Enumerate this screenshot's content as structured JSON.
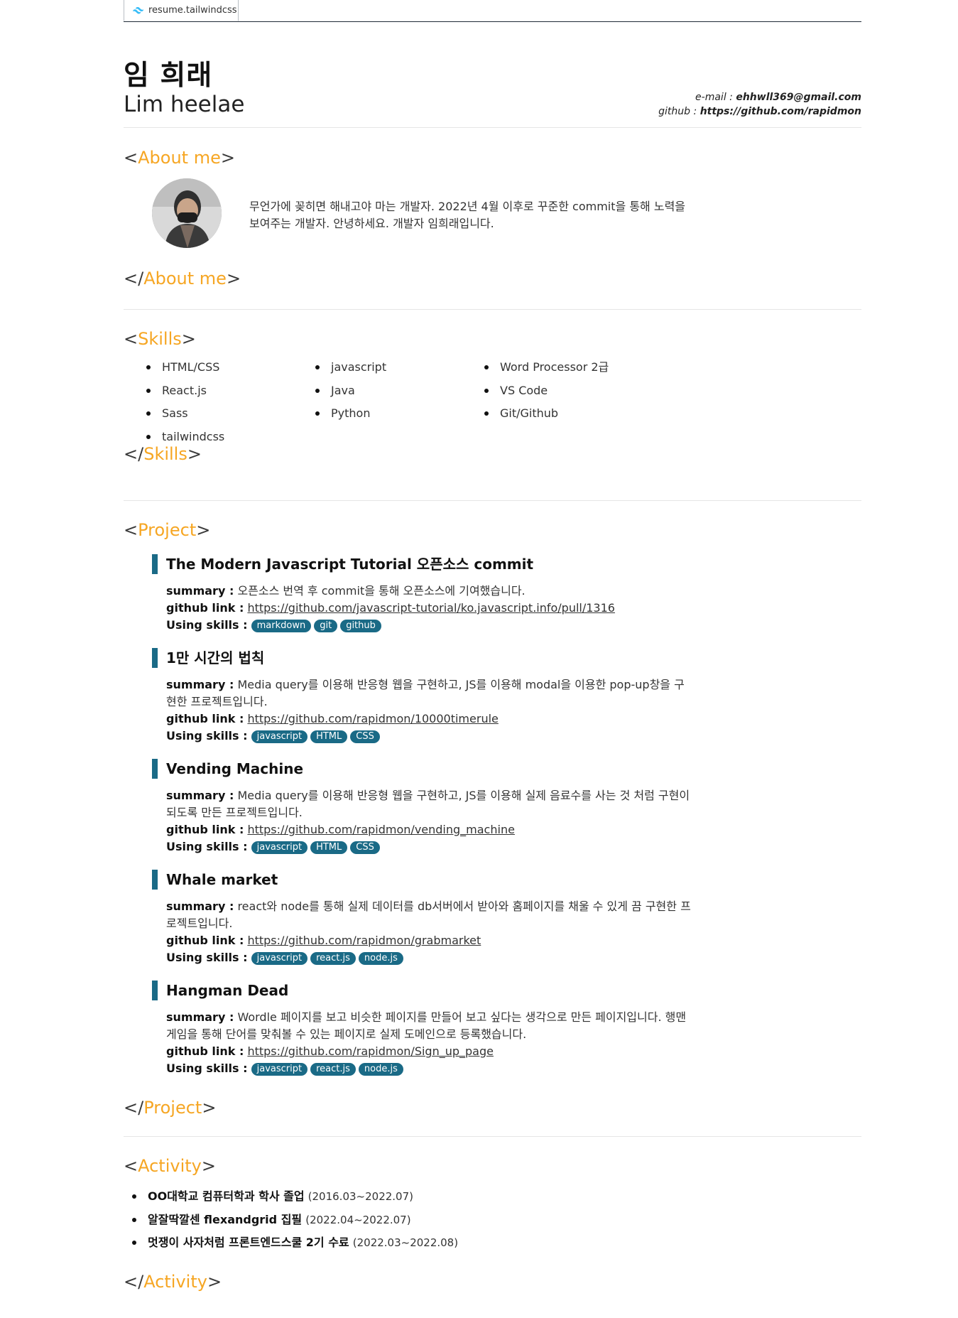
{
  "tab": {
    "title": "resume.tailwindcss"
  },
  "header": {
    "name_ko": "임 희래",
    "name_en": "Lim heelae",
    "email_label": "e-mail :",
    "email": "ehhwll369@gmail.com",
    "github_label": "github :",
    "github": "https://github.com/rapidmon"
  },
  "tag": {
    "lt": "<",
    "ltslash": "</",
    "gt": ">"
  },
  "about": {
    "title": "About me",
    "text": "무언가에 꽂히면 해내고야 마는 개발자. 2022년 4월 이후로 꾸준한 commit을 통해 노력을 보여주는 개발자. 안녕하세요. 개발자 임희래입니다."
  },
  "skills": {
    "title": "Skills",
    "col1": [
      "HTML/CSS",
      "React.js",
      "Sass",
      "tailwindcss"
    ],
    "col2": [
      "javascript",
      "Java",
      "Python"
    ],
    "col3": [
      "Word Processor 2급",
      "VS Code",
      "Git/Github"
    ]
  },
  "project": {
    "title": "Project",
    "summary_label": "summary :",
    "github_label": "github link :",
    "skills_label": "Using skills :",
    "items": [
      {
        "title": "The Modern Javascript Tutorial 오픈소스 commit",
        "summary": "오픈소스 번역 후 commit을 통해 오픈소스에 기여했습니다.",
        "link": "https://github.com/javascript-tutorial/ko.javascript.info/pull/1316",
        "skills": [
          "markdown",
          "git",
          "github"
        ]
      },
      {
        "title": "1만 시간의 법칙",
        "summary": "Media query를 이용해 반응형 웹을 구현하고, JS를 이용해 modal을 이용한 pop-up창을 구현한 프로젝트입니다.",
        "link": "https://github.com/rapidmon/10000timerule",
        "skills": [
          "javascript",
          "HTML",
          "CSS"
        ]
      },
      {
        "title": "Vending Machine",
        "summary": "Media query를 이용해 반응형 웹을 구현하고, JS를 이용해 실제 음료수를 사는 것 처럼 구현이 되도록 만든 프로젝트입니다.",
        "link": "https://github.com/rapidmon/vending_machine",
        "skills": [
          "javascript",
          "HTML",
          "CSS"
        ]
      },
      {
        "title": "Whale market",
        "summary": "react와 node를 통해 실제 데이터를 db서버에서 받아와 홈페이지를 채울 수 있게 끔 구현한 프로젝트입니다.",
        "link": "https://github.com/rapidmon/grabmarket",
        "skills": [
          "javascript",
          "react.js",
          "node.js"
        ]
      },
      {
        "title": "Hangman Dead",
        "summary": "Wordle 페이지를 보고 비슷한 페이지를 만들어 보고 싶다는 생각으로 만든 페이지입니다. 행맨 게임을 통해 단어를 맞춰볼 수 있는 페이지로 실제 도메인으로 등록했습니다.",
        "link": "https://github.com/rapidmon/Sign_up_page",
        "skills": [
          "javascript",
          "react.js",
          "node.js"
        ]
      }
    ]
  },
  "activity": {
    "title": "Activity",
    "items": [
      {
        "name": "OO대학교 컴퓨터학과 학사 졸업",
        "period": "(2016.03~2022.07)"
      },
      {
        "name": "알잘딱깔센 flexandgrid 집필",
        "period": "(2022.04~2022.07)"
      },
      {
        "name": "멋쟁이 사자처럼 프론트엔드스쿨 2기 수료",
        "period": "(2022.03~2022.08)"
      }
    ]
  },
  "colors": {
    "accent": "#f6a623",
    "chip": "#1a6a86",
    "text": "#333333"
  }
}
